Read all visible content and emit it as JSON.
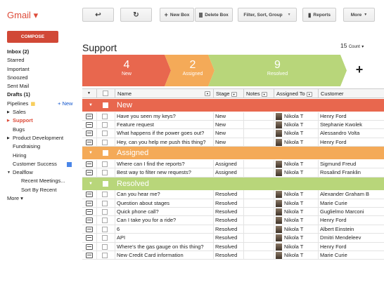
{
  "app": {
    "title": "Gmail",
    "caret": "▾"
  },
  "compose_label": "COMPOSE",
  "nav": {
    "inbox": "Inbox (2)",
    "starred": "Starred",
    "important": "Important",
    "snoozed": "Snoozed",
    "sent": "Sent Mail",
    "drafts": "Drafts (1)",
    "pipelines": "Pipelines",
    "new_link": "+ New",
    "sales": "Sales",
    "support": "Support",
    "bugs": "Bugs",
    "product_dev": "Product Development",
    "fundraising": "Fundraising",
    "hiring": "Hiring",
    "customer_success": "Customer Success",
    "dealflow": "Dealflow",
    "recent_meetings": "Recent Meetings...",
    "sort_by_recent": "Sort By Recent",
    "more": "More ▾"
  },
  "toolbar": {
    "back": "↩",
    "refresh": "↻",
    "new_box": "New Box",
    "delete_box": "Delete Box",
    "filter": "Filter, Sort, Group",
    "reports": "Reports",
    "more": "More"
  },
  "page": {
    "title": "Support",
    "count": "15",
    "count_label": "Count"
  },
  "pipeline": [
    {
      "num": "4",
      "label": "New",
      "color": "#e8674e"
    },
    {
      "num": "2",
      "label": "Assigned",
      "color": "#f4aa58"
    },
    {
      "num": "9",
      "label": "Resolved",
      "color": "#b8d67a"
    }
  ],
  "pipeline_add": "+",
  "columns": {
    "name": "Name",
    "stage": "Stage",
    "notes": "Notes",
    "assigned": "Assigned To",
    "customer": "Customer"
  },
  "groups": [
    {
      "name": "New",
      "color": "#e8674e",
      "rows": [
        {
          "name": "Have you seen my keys?",
          "stage": "New",
          "assigned": "Nikola T",
          "customer": "Henry Ford"
        },
        {
          "name": "Feature request",
          "stage": "New",
          "assigned": "Nikola T",
          "customer": "Stephanie Kwolek"
        },
        {
          "name": "What happens if the power goes out?",
          "stage": "New",
          "assigned": "Nikola T",
          "customer": "Alessandro Volta"
        },
        {
          "name": "Hey, can you help me push this thing?",
          "stage": "New",
          "assigned": "Nikola T",
          "customer": "Henry Ford"
        }
      ]
    },
    {
      "name": "Assigned",
      "color": "#f4aa58",
      "rows": [
        {
          "name": "Where can I find the reports?",
          "stage": "Assigned",
          "assigned": "Nikola T",
          "customer": "Sigmund Freud"
        },
        {
          "name": "Best way to filter new requests?",
          "stage": "Assigned",
          "assigned": "Nikola T",
          "customer": "Rosalind Franklin"
        }
      ]
    },
    {
      "name": "Resolved",
      "color": "#b8d67a",
      "rows": [
        {
          "name": "Can you hear me?",
          "stage": "Resolved",
          "assigned": "Nikola T",
          "customer": "Alexander Graham B"
        },
        {
          "name": "Question about stages",
          "stage": "Resolved",
          "assigned": "Nikola T",
          "customer": "Marie Curie"
        },
        {
          "name": "Quick phone call?",
          "stage": "Resolved",
          "assigned": "Nikola T",
          "customer": "Guglielmo Marconi"
        },
        {
          "name": "Can I take you for a ride?",
          "stage": "Resolved",
          "assigned": "Nikola T",
          "customer": "Henry Ford"
        },
        {
          "name": "6",
          "stage": "Resolved",
          "assigned": "Nikola T",
          "customer": "Albert Einstein"
        },
        {
          "name": "API",
          "stage": "Resolved",
          "assigned": "Nikola T",
          "customer": "Dmitri Mendeleev"
        },
        {
          "name": "Where's the gas gauge on this thing?",
          "stage": "Resolved",
          "assigned": "Nikola T",
          "customer": "Henry Ford"
        },
        {
          "name": "New Credit Card information",
          "stage": "Resolved",
          "assigned": "Nikola T",
          "customer": "Marie Curie"
        }
      ]
    }
  ]
}
